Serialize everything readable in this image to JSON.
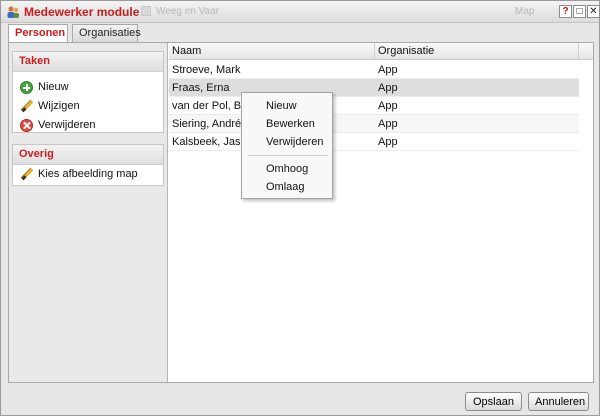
{
  "window": {
    "title": "Medewerker module",
    "bg_ghost_left": "Weeg en Vaar",
    "bg_ghost_right": "Map",
    "help": "?",
    "maximize": "□",
    "close": "✕"
  },
  "tabs": [
    {
      "label": "Personen",
      "active": true
    },
    {
      "label": "Organisaties",
      "active": false
    }
  ],
  "sidebar": {
    "taken": {
      "header": "Taken",
      "items": [
        {
          "label": "Nieuw",
          "icon": "add-icon"
        },
        {
          "label": "Wijzigen",
          "icon": "pencil-icon"
        },
        {
          "label": "Verwijderen",
          "icon": "delete-icon"
        }
      ]
    },
    "overig": {
      "header": "Overig",
      "items": [
        {
          "label": "Kies afbeelding map",
          "icon": "pencil-icon"
        }
      ]
    }
  },
  "grid": {
    "columns": [
      "Naam",
      "Organisatie"
    ],
    "rows": [
      {
        "naam": "Stroeve, Mark",
        "organisatie": "App"
      },
      {
        "naam": "Fraas, Erna",
        "organisatie": "App"
      },
      {
        "naam": "van der Pol, Barry",
        "organisatie": "App"
      },
      {
        "naam": "Siering, André",
        "organisatie": "App"
      },
      {
        "naam": "Kalsbeek, Jasper",
        "organisatie": "App"
      }
    ],
    "selected_row": 1
  },
  "context_menu": {
    "items": [
      "Nieuw",
      "Bewerken",
      "Verwijderen",
      "Omhoog",
      "Omlaag"
    ]
  },
  "buttons": {
    "save": "Opslaan",
    "cancel": "Annuleren"
  },
  "colors": {
    "accent": "#cc1c1c"
  }
}
